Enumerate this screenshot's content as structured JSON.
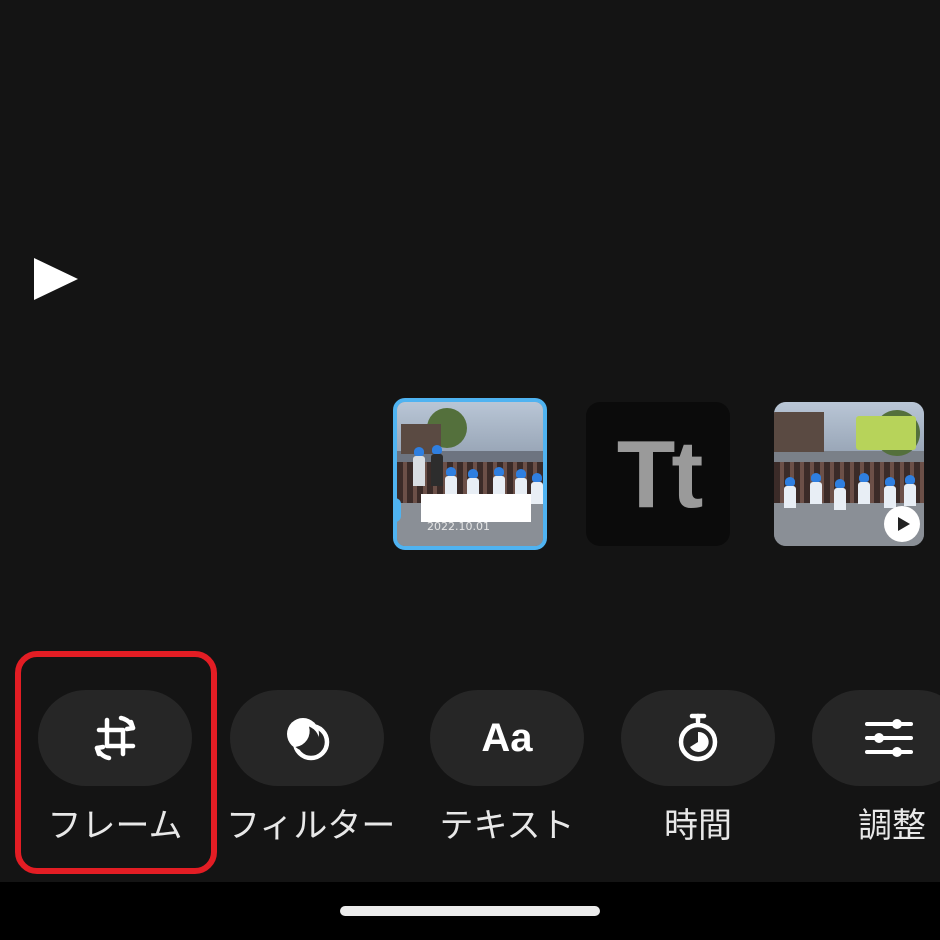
{
  "player": {
    "play_icon": "play-icon"
  },
  "timeline": {
    "clips": [
      {
        "type": "photo",
        "selected": true,
        "date_text": "2022.10.01",
        "accent": "#4fb3f1"
      },
      {
        "type": "text",
        "glyph": "Tt"
      },
      {
        "type": "video",
        "badge_icon": "play-icon"
      }
    ]
  },
  "toolbar": {
    "tools": [
      {
        "label": "フレーム",
        "icon": "crop-rotate-icon",
        "highlighted": true
      },
      {
        "label": "フィルター",
        "icon": "filter-circles-icon"
      },
      {
        "label": "テキスト",
        "icon": "text-aa-icon",
        "icon_text": "Aa"
      },
      {
        "label": "時間",
        "icon": "stopwatch-icon"
      },
      {
        "label": "調整",
        "icon": "sliders-icon"
      }
    ]
  },
  "colors": {
    "highlight": "#e31d24",
    "selection": "#4fb3f1",
    "background": "#141414"
  }
}
